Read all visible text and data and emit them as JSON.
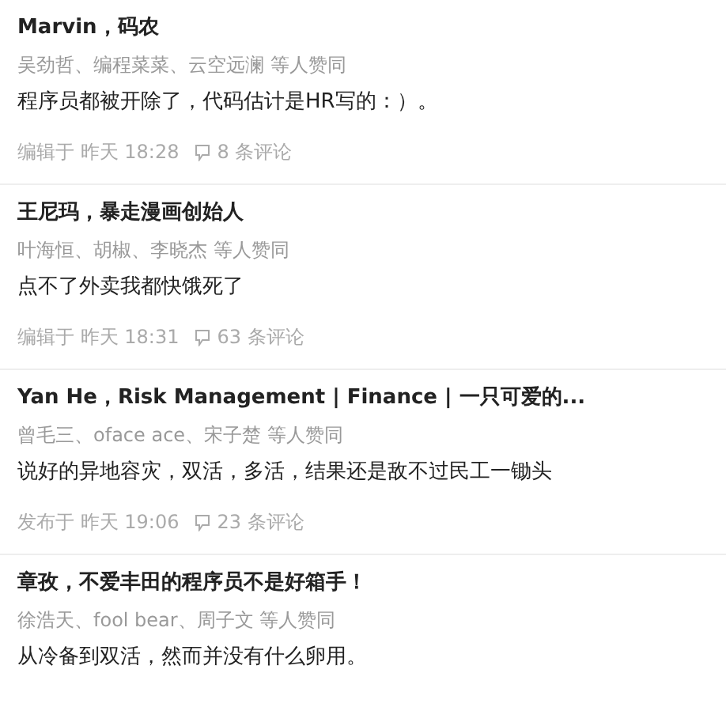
{
  "answers": [
    {
      "author": "Marvin，码农",
      "voters": "吴劲哲、编程菜菜、云空远澜 等人赞同",
      "body": "程序员都被开除了，代码估计是HR写的：）。",
      "time": "编辑于 昨天 18:28",
      "comments": "8 条评论"
    },
    {
      "author": "王尼玛，暴走漫画创始人",
      "voters": "叶海恒、胡椒、李晓杰 等人赞同",
      "body": "点不了外卖我都快饿死了",
      "time": "编辑于 昨天 18:31",
      "comments": "63 条评论"
    },
    {
      "author": "Yan He，Risk Management | Finance | 一只可爱的...",
      "voters": "曾毛三、oface ace、宋子楚 等人赞同",
      "body": "说好的异地容灾，双活，多活，结果还是敌不过民工一锄头",
      "time": "发布于 昨天 19:06",
      "comments": "23 条评论"
    },
    {
      "author": "章孜，不爱丰田的程序员不是好箱手！",
      "voters": "徐浩天、fool bear、周子文 等人赞同",
      "body": "从冷备到双活，然而并没有什么卵用。"
    }
  ]
}
